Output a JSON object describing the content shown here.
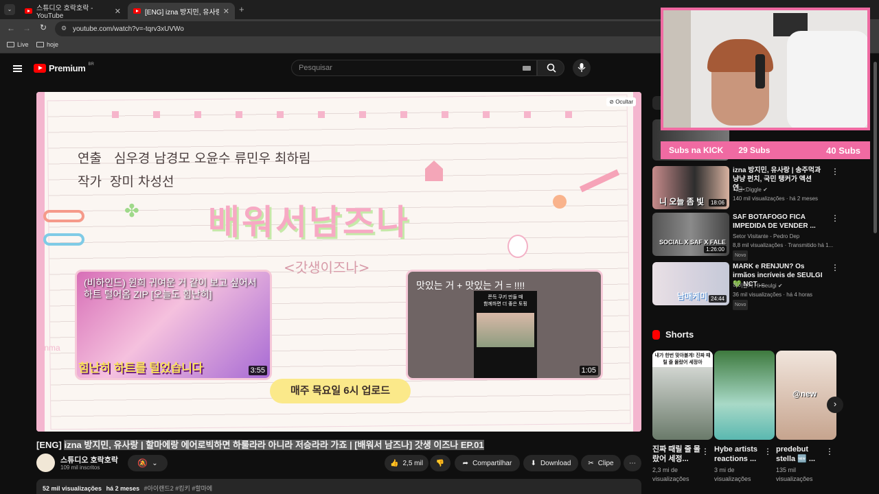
{
  "browser": {
    "tabs": [
      {
        "title": "스튜디오 호락호락 - YouTube",
        "active": false
      },
      {
        "title": "[ENG] izna 방지민, 유사랑 | 할",
        "active": true
      }
    ],
    "url": "youtube.com/watch?v=-tqrv3xUVWo",
    "bookmarks": [
      "Live",
      "hoje"
    ]
  },
  "youtube": {
    "logo_text": "Premium",
    "region": "BR",
    "search_placeholder": "Pesquisar"
  },
  "video_frame": {
    "hide_label": "Ocultar",
    "credit_director": "연출   심우경 남경모 오윤수 류민우 최하림",
    "credit_writer": "작가  장미 차성선",
    "show_title": "배워서남즈나",
    "show_subtitle": "<갓생이즈나>",
    "card1_text": "(비하인드) 윈희 귀여운 거 같이 보고 싶어서 하트 털어옴 ZIP [오늘도 힘난히]",
    "card1_banner": "힘난히 하트를 털었습니다",
    "card1_duration": "3:55",
    "card2_text": "맛있는 거 + 맛있는 거 = !!!!",
    "card2_sub": "쫀득 쿠키 만들 때\n함께하면 더 좋은 토핑",
    "card2_duration": "1:05",
    "upload_schedule": "매주 목요일 6시 업로드",
    "watermark": "oTenma"
  },
  "video": {
    "title_prefix": "[ENG]",
    "title": "izna 방지민, 유사랑 | 할마에랑 에어로빅하면 하룰라라 아니라 저승라라 가죠 | [배워서 남즈나] 갓생 이즈나 EP.01",
    "channel": "스튜디오 호락호락",
    "subscribers": "109 mil inscritos",
    "likes": "2,5 mil",
    "share": "Compartilhar",
    "download": "Download",
    "clip": "Clipe",
    "views": "52 mil visualizações",
    "date": "há 2 meses",
    "hashtags": "#아이랜드2 #킹키 #할마에"
  },
  "sidebar": {
    "videos": [
      {
        "title": "izna 방지민, 유사랑 | 송주먹과 냥냥 펀치, 국민 탱커가 액션 연...",
        "channel": "디글 :Diggle",
        "verified": true,
        "meta": "140 mil visualizações · há 2 meses",
        "duration": "18:06",
        "thumb_text": "니 오늘 좀 빛",
        "badge": ""
      },
      {
        "title": "SAF BOTAFOGO FICA IMPEDIDA DE VENDER ...",
        "channel": "Setor Visitante - Pedro Dep",
        "verified": false,
        "meta": "8,8 mil visualizações · Transmitido há 1...",
        "duration": "1:26:00",
        "thumb_text": "SOCIAL X SAF X FALE",
        "badge": "Novo"
      },
      {
        "title": "MARK e RENJUN? Os irmãos incríveis de SEULGI 💚 NCT ...",
        "channel": "하이슬기 Hi Seulgi",
        "verified": true,
        "meta": "36 mil visualizações · há 4 horas",
        "duration": "24:44",
        "thumb_text": "남매케미",
        "badge": "Novo"
      }
    ],
    "shorts_label": "Shorts",
    "shorts": [
      {
        "title": "진짜 때릴 줄 몰랐어 세정...",
        "views": "2,3 mi de visualizações",
        "overlay": "내가 한번 맞아볼게! 진짜 때릴 줄 몰랐어 세정아"
      },
      {
        "title": "Hybe artists reactions ...",
        "views": "3 mi de visualizações",
        "overlay": ""
      },
      {
        "title": "predebut stella 🆕 ...",
        "views": "135 mil visualizações",
        "overlay": "@new"
      }
    ]
  },
  "overlay": {
    "kick_label": "Subs na KICK",
    "kick_subs": "29 Subs",
    "total_subs": "40 Subs"
  }
}
